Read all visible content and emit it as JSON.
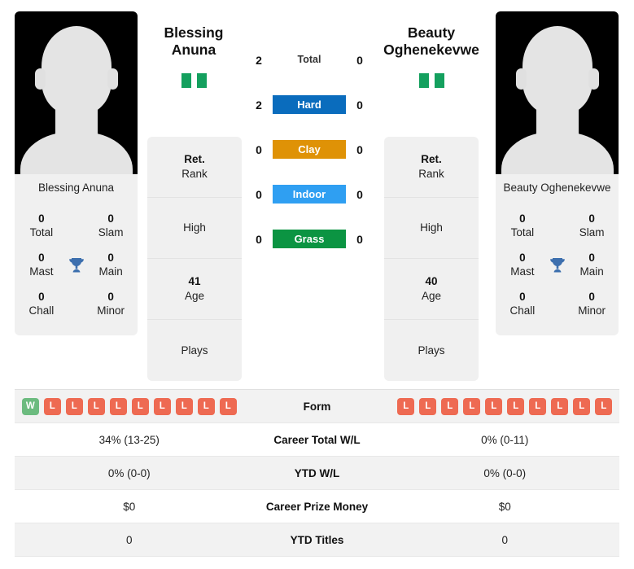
{
  "players": {
    "left": {
      "first_name": "Blessing",
      "last_name": "Anuna",
      "full_name": "Blessing Anuna",
      "flag_name": "nigeria-flag",
      "titles": [
        {
          "value": "0",
          "label": "Total"
        },
        {
          "value": "0",
          "label": "Slam"
        },
        {
          "value": "0",
          "label": "Mast"
        },
        {
          "value": "0",
          "label": "Main"
        },
        {
          "value": "0",
          "label": "Chall"
        },
        {
          "value": "0",
          "label": "Minor"
        }
      ],
      "info": [
        {
          "value": "Ret.",
          "label": "Rank"
        },
        {
          "value": "",
          "label": "High"
        },
        {
          "value": "41",
          "label": "Age"
        },
        {
          "value": "",
          "label": "Plays"
        }
      ],
      "form": [
        "W",
        "L",
        "L",
        "L",
        "L",
        "L",
        "L",
        "L",
        "L",
        "L"
      ]
    },
    "right": {
      "first_name": "Beauty",
      "last_name": "Oghenekevwe",
      "full_name": "Beauty Oghenekevwe",
      "flag_name": "nigeria-flag",
      "titles": [
        {
          "value": "0",
          "label": "Total"
        },
        {
          "value": "0",
          "label": "Slam"
        },
        {
          "value": "0",
          "label": "Mast"
        },
        {
          "value": "0",
          "label": "Main"
        },
        {
          "value": "0",
          "label": "Chall"
        },
        {
          "value": "0",
          "label": "Minor"
        }
      ],
      "info": [
        {
          "value": "Ret.",
          "label": "Rank"
        },
        {
          "value": "",
          "label": "High"
        },
        {
          "value": "40",
          "label": "Age"
        },
        {
          "value": "",
          "label": "Plays"
        }
      ],
      "form": [
        "L",
        "L",
        "L",
        "L",
        "L",
        "L",
        "L",
        "L",
        "L",
        "L"
      ]
    }
  },
  "surfaces": [
    {
      "label": "Total",
      "left": "2",
      "right": "0",
      "color": "transparent",
      "text_color": "#333333"
    },
    {
      "label": "Hard",
      "left": "2",
      "right": "0",
      "color": "#0a6cbd",
      "text_color": "#ffffff"
    },
    {
      "label": "Clay",
      "left": "0",
      "right": "0",
      "color": "#df9206",
      "text_color": "#ffffff"
    },
    {
      "label": "Indoor",
      "left": "0",
      "right": "0",
      "color": "#2f9ff2",
      "text_color": "#ffffff"
    },
    {
      "label": "Grass",
      "left": "0",
      "right": "0",
      "color": "#0b9442",
      "text_color": "#ffffff"
    }
  ],
  "stats_rows": [
    {
      "label": "Form",
      "left": "",
      "right": "",
      "type": "form"
    },
    {
      "label": "Career Total W/L",
      "left": "34% (13-25)",
      "right": "0% (0-11)",
      "type": "text"
    },
    {
      "label": "YTD W/L",
      "left": "0% (0-0)",
      "right": "0% (0-0)",
      "type": "text"
    },
    {
      "label": "Career Prize Money",
      "left": "$0",
      "right": "$0",
      "type": "text"
    },
    {
      "label": "YTD Titles",
      "left": "0",
      "right": "0",
      "type": "text"
    }
  ],
  "colors": {
    "win_badge": "#6cbb7f",
    "loss_badge": "#ee6a52",
    "trophy": "#3d6fae",
    "flag_green": "#14a05e",
    "card_bg": "#f0f0f0"
  }
}
